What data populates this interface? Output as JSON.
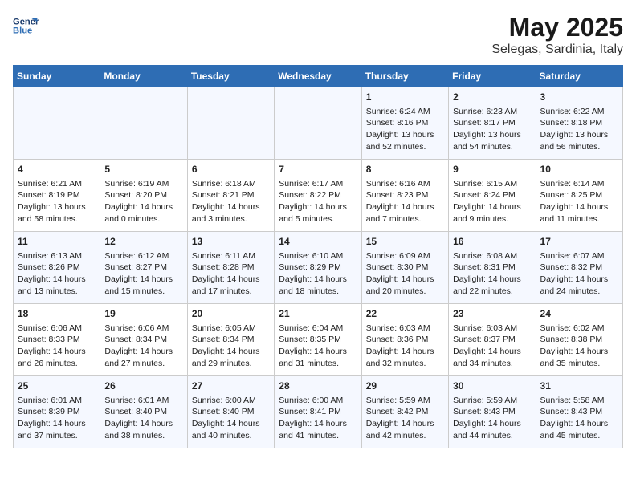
{
  "logo": {
    "line1": "General",
    "line2": "Blue"
  },
  "title": "May 2025",
  "subtitle": "Selegas, Sardinia, Italy",
  "days_of_week": [
    "Sunday",
    "Monday",
    "Tuesday",
    "Wednesday",
    "Thursday",
    "Friday",
    "Saturday"
  ],
  "weeks": [
    [
      {
        "day": "",
        "info": ""
      },
      {
        "day": "",
        "info": ""
      },
      {
        "day": "",
        "info": ""
      },
      {
        "day": "",
        "info": ""
      },
      {
        "day": "1",
        "info": "Sunrise: 6:24 AM\nSunset: 8:16 PM\nDaylight: 13 hours\nand 52 minutes."
      },
      {
        "day": "2",
        "info": "Sunrise: 6:23 AM\nSunset: 8:17 PM\nDaylight: 13 hours\nand 54 minutes."
      },
      {
        "day": "3",
        "info": "Sunrise: 6:22 AM\nSunset: 8:18 PM\nDaylight: 13 hours\nand 56 minutes."
      }
    ],
    [
      {
        "day": "4",
        "info": "Sunrise: 6:21 AM\nSunset: 8:19 PM\nDaylight: 13 hours\nand 58 minutes."
      },
      {
        "day": "5",
        "info": "Sunrise: 6:19 AM\nSunset: 8:20 PM\nDaylight: 14 hours\nand 0 minutes."
      },
      {
        "day": "6",
        "info": "Sunrise: 6:18 AM\nSunset: 8:21 PM\nDaylight: 14 hours\nand 3 minutes."
      },
      {
        "day": "7",
        "info": "Sunrise: 6:17 AM\nSunset: 8:22 PM\nDaylight: 14 hours\nand 5 minutes."
      },
      {
        "day": "8",
        "info": "Sunrise: 6:16 AM\nSunset: 8:23 PM\nDaylight: 14 hours\nand 7 minutes."
      },
      {
        "day": "9",
        "info": "Sunrise: 6:15 AM\nSunset: 8:24 PM\nDaylight: 14 hours\nand 9 minutes."
      },
      {
        "day": "10",
        "info": "Sunrise: 6:14 AM\nSunset: 8:25 PM\nDaylight: 14 hours\nand 11 minutes."
      }
    ],
    [
      {
        "day": "11",
        "info": "Sunrise: 6:13 AM\nSunset: 8:26 PM\nDaylight: 14 hours\nand 13 minutes."
      },
      {
        "day": "12",
        "info": "Sunrise: 6:12 AM\nSunset: 8:27 PM\nDaylight: 14 hours\nand 15 minutes."
      },
      {
        "day": "13",
        "info": "Sunrise: 6:11 AM\nSunset: 8:28 PM\nDaylight: 14 hours\nand 17 minutes."
      },
      {
        "day": "14",
        "info": "Sunrise: 6:10 AM\nSunset: 8:29 PM\nDaylight: 14 hours\nand 18 minutes."
      },
      {
        "day": "15",
        "info": "Sunrise: 6:09 AM\nSunset: 8:30 PM\nDaylight: 14 hours\nand 20 minutes."
      },
      {
        "day": "16",
        "info": "Sunrise: 6:08 AM\nSunset: 8:31 PM\nDaylight: 14 hours\nand 22 minutes."
      },
      {
        "day": "17",
        "info": "Sunrise: 6:07 AM\nSunset: 8:32 PM\nDaylight: 14 hours\nand 24 minutes."
      }
    ],
    [
      {
        "day": "18",
        "info": "Sunrise: 6:06 AM\nSunset: 8:33 PM\nDaylight: 14 hours\nand 26 minutes."
      },
      {
        "day": "19",
        "info": "Sunrise: 6:06 AM\nSunset: 8:34 PM\nDaylight: 14 hours\nand 27 minutes."
      },
      {
        "day": "20",
        "info": "Sunrise: 6:05 AM\nSunset: 8:34 PM\nDaylight: 14 hours\nand 29 minutes."
      },
      {
        "day": "21",
        "info": "Sunrise: 6:04 AM\nSunset: 8:35 PM\nDaylight: 14 hours\nand 31 minutes."
      },
      {
        "day": "22",
        "info": "Sunrise: 6:03 AM\nSunset: 8:36 PM\nDaylight: 14 hours\nand 32 minutes."
      },
      {
        "day": "23",
        "info": "Sunrise: 6:03 AM\nSunset: 8:37 PM\nDaylight: 14 hours\nand 34 minutes."
      },
      {
        "day": "24",
        "info": "Sunrise: 6:02 AM\nSunset: 8:38 PM\nDaylight: 14 hours\nand 35 minutes."
      }
    ],
    [
      {
        "day": "25",
        "info": "Sunrise: 6:01 AM\nSunset: 8:39 PM\nDaylight: 14 hours\nand 37 minutes."
      },
      {
        "day": "26",
        "info": "Sunrise: 6:01 AM\nSunset: 8:40 PM\nDaylight: 14 hours\nand 38 minutes."
      },
      {
        "day": "27",
        "info": "Sunrise: 6:00 AM\nSunset: 8:40 PM\nDaylight: 14 hours\nand 40 minutes."
      },
      {
        "day": "28",
        "info": "Sunrise: 6:00 AM\nSunset: 8:41 PM\nDaylight: 14 hours\nand 41 minutes."
      },
      {
        "day": "29",
        "info": "Sunrise: 5:59 AM\nSunset: 8:42 PM\nDaylight: 14 hours\nand 42 minutes."
      },
      {
        "day": "30",
        "info": "Sunrise: 5:59 AM\nSunset: 8:43 PM\nDaylight: 14 hours\nand 44 minutes."
      },
      {
        "day": "31",
        "info": "Sunrise: 5:58 AM\nSunset: 8:43 PM\nDaylight: 14 hours\nand 45 minutes."
      }
    ]
  ]
}
